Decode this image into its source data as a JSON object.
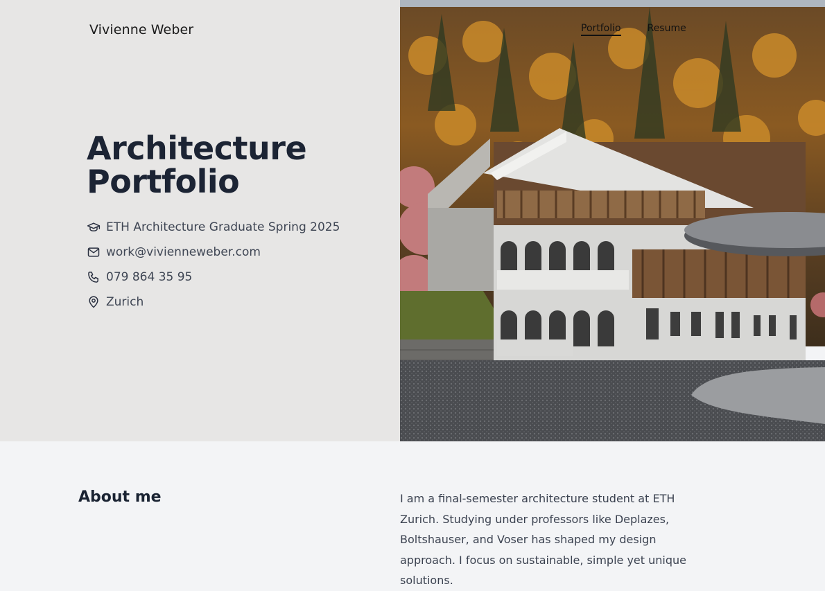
{
  "header": {
    "brand": "Vivienne Weber",
    "nav": [
      {
        "label": "Portfolio",
        "active": true
      },
      {
        "label": "Resume",
        "active": false
      }
    ]
  },
  "hero": {
    "title_line1": "Architecture",
    "title_line2": "Portfolio",
    "contacts": [
      {
        "icon": "graduation-cap-icon",
        "text": "ETH Architecture Graduate Spring 2025"
      },
      {
        "icon": "mail-icon",
        "text": "work@vivienneweber.com"
      },
      {
        "icon": "phone-icon",
        "text": "079 864 35 95"
      },
      {
        "icon": "map-pin-icon",
        "text": "Zurich"
      }
    ],
    "image_subject": "architectural-rendering-of-timber-and-stone-building-in-autumn-forest"
  },
  "about": {
    "heading": "About me",
    "body": "I am a final-semester architecture student at ETH Zurich. Studying under professors like Deplazes, Boltshauser, and Voser has shaped my design approach. I focus on sustainable, simple yet unique solutions."
  },
  "colors": {
    "hero_left_bg": "#e7e6e5",
    "page_bg": "#f3f4f6",
    "title_text": "#1c2434",
    "body_text": "#3f4654"
  }
}
